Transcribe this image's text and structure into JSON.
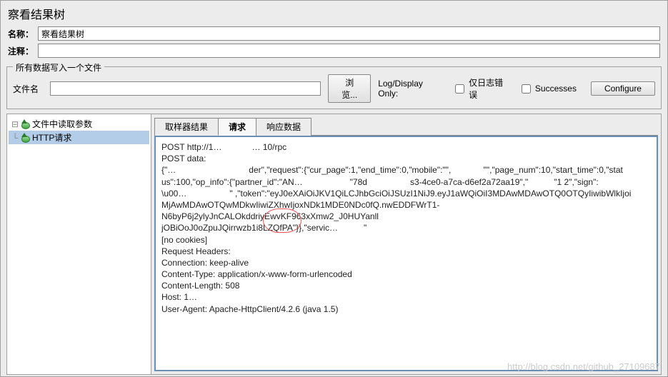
{
  "panel": {
    "title": "察看结果树",
    "labels": {
      "name": "名称：",
      "comment": "注释："
    },
    "name_value": "察看结果树",
    "comment_value": ""
  },
  "filegroup": {
    "legend": "所有数据写入一个文件",
    "filename_label": "文件名",
    "filename_value": "",
    "browse": "浏览...",
    "logdisplay": "Log/Display Only:",
    "error_only": "仅日志错误",
    "successes": "Successes",
    "configure": "Configure"
  },
  "tree": {
    "item1": "文件中读取参数",
    "item2": "HTTP请求"
  },
  "tabs": {
    "sampler": "取样器结果",
    "request": "请求",
    "response": "响应数据"
  },
  "request": {
    "line_post_url": "POST http://1…       … 10/rpc",
    "line_blank1": " ",
    "post_data_label": "POST data:",
    "body_l1": "{\"…                 der\",\"request\":{\"cur_page\":1,\"end_time\":0,\"mobile\":\"\",        \"\",\"page_num\":10,\"start_time\":0,\"stat",
    "body_l2": "us\":100,\"op_info\":{\"partner_id\":\"AN…           \"78d          s3-4ce0-a7ca-d6ef2a72aa19\",\"      \"1 2\",\"sign\":",
    "body_l3": "\\u00…          \" ,\"token\":\"eyJ0eXAiOiJKV1QiLCJhbGciOiJSUzI1NiJ9.eyJ1aWQiOiI3MDAwMDAwOTQ0OTQyIiwibWlkIjoi",
    "body_l4": "MjAwMDAwOTQwMDkwIiwiZXhwIjoxNDk1MDE0NDc0fQ.nwEDDFWrT1-N6byP6j2ylyJnCALOkddriyEwvKF963xXmw2_J0HUYanll",
    "body_l5": "jOBiOoJ0oZpuJQirrwzb1i8LZQfPA\"}},\"servic…      \"",
    "line_blank2": " ",
    "no_cookies": "[no cookies]",
    "line_blank3": " ",
    "headers_label": "Request Headers:",
    "h1": "Connection: keep-alive",
    "h2": "Content-Type: application/x-www-form-urlencoded",
    "h3": "Content-Length: 508",
    "h4": "Host: 1…            ",
    "h5": "User-Agent: Apache-HttpClient/4.2.6 (java 1.5)"
  },
  "watermark": "http://blog.csdn.net/github_27109687"
}
